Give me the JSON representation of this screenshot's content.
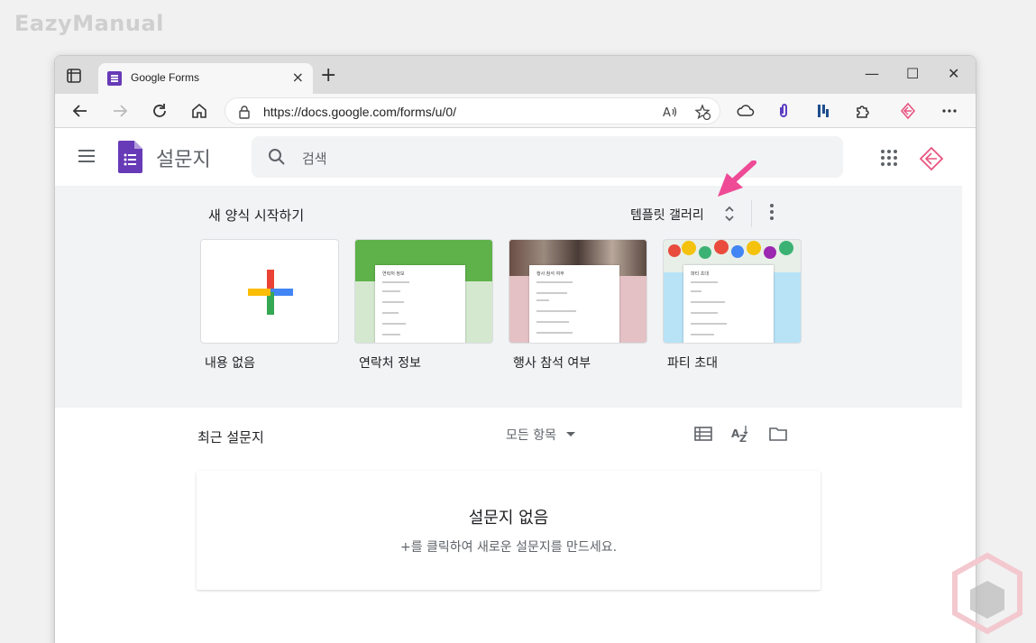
{
  "watermark": "EazyManual",
  "browser": {
    "tab_title": "Google Forms",
    "tab_close": "×",
    "new_tab": "+",
    "url": "https://docs.google.com/forms/u/0/",
    "window_controls": {
      "minimize": "—",
      "maximize": "☐",
      "close": "✕"
    }
  },
  "header": {
    "title": "설문지",
    "search_placeholder": "검색"
  },
  "start": {
    "title": "새 양식 시작하기",
    "gallery_label": "템플릿 갤러리",
    "templates": [
      {
        "label": "내용 없음"
      },
      {
        "label": "연락처 정보",
        "doc_title": "연락처 정보"
      },
      {
        "label": "행사 참석 여부",
        "doc_title": "행사 참석 여부"
      },
      {
        "label": "파티 초대",
        "doc_title": "파티 초대"
      }
    ]
  },
  "recent": {
    "title": "최근 설문지",
    "filter": "모든 항목",
    "empty_title": "설문지 없음",
    "empty_subtitle": "+를 클릭하여 새로운 설문지를 만드세요."
  },
  "colors": {
    "forms_purple": "#673ab7",
    "accent_pink": "#ee4a96",
    "contact_green": "#5fb24a",
    "rsvp_pink": "#e3c1c4",
    "party_blue": "#b8e3f6"
  }
}
